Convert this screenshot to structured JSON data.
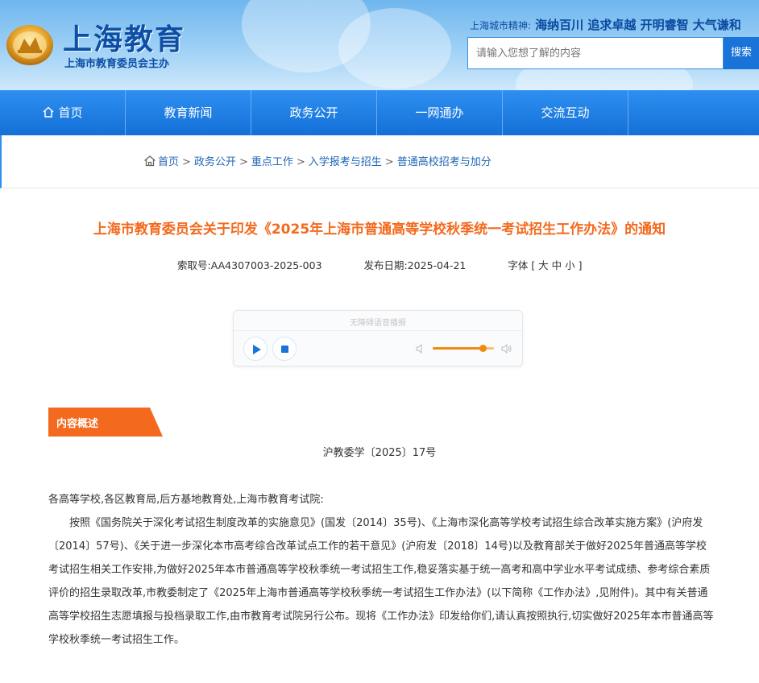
{
  "header": {
    "site_title": "上海教育",
    "site_subtitle": "上海市教育委员会主办",
    "spirit_label": "上海城市精神:",
    "spirit_value": "海纳百川 追求卓越 开明睿智 大气谦和",
    "search_placeholder": "请输入您想了解的内容",
    "search_button": "搜索"
  },
  "nav": {
    "items": [
      {
        "label": "首页"
      },
      {
        "label": "教育新闻"
      },
      {
        "label": "政务公开"
      },
      {
        "label": "一网通办"
      },
      {
        "label": "交流互动"
      }
    ]
  },
  "breadcrumb": {
    "items": [
      "首页",
      "政务公开",
      "重点工作",
      "入学报考与招生",
      "普通高校招考与加分"
    ],
    "separator": ">"
  },
  "article": {
    "title": "上海市教育委员会关于印发《2025年上海市普通高等学校秋季统一考试招生工作办法》的通知",
    "index_no": "索取号:AA4307003-2025-003",
    "publish_date": "发布日期:2025-04-21",
    "font_size": "字体 [ 大 中 小 ]"
  },
  "player": {
    "caption": "无障碍语音播报",
    "volume_level": 0.82
  },
  "section": {
    "label": "内容概述"
  },
  "document": {
    "doc_number": "沪教委学〔2025〕17号",
    "salutation": "各高等学校,各区教育局,后方基地教育处,上海市教育考试院:",
    "paragraph": "按照《国务院关于深化考试招生制度改革的实施意见》(国发〔2014〕35号)、《上海市深化高等学校考试招生综合改革实施方案》(沪府发〔2014〕57号)、《关于进一步深化本市高考综合改革试点工作的若干意见》(沪府发〔2018〕14号)以及教育部关于做好2025年普通高等学校考试招生相关工作安排,为做好2025年本市普通高等学校秋季统一考试招生工作,稳妥落实基于统一高考和高中学业水平考试成绩、参考综合素质评价的招生录取改革,市教委制定了《2025年上海市普通高等学校秋季统一考试招生工作办法》(以下简称《工作办法》,见附件)。其中有关普通高等学校招生志愿填报与投档录取工作,由市教育考试院另行公布。现将《工作办法》印发给你们,请认真按照执行,切实做好2025年本市普通高等学校秋季统一考试招生工作。"
  },
  "colors": {
    "brand_blue": "#1370d8",
    "title_orange": "#f36a1e",
    "link_blue": "#2266b5"
  }
}
